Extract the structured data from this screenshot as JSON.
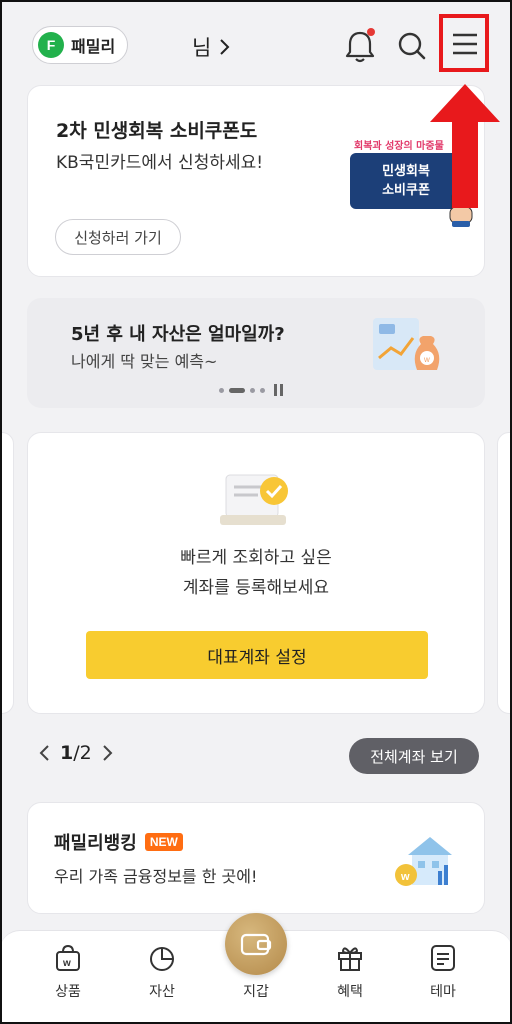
{
  "header": {
    "family_label": "패밀리",
    "family_icon_letter": "F",
    "user_name": "님"
  },
  "promo": {
    "title": "2차 민생회복 소비쿠폰도",
    "subtitle": "KB국민카드에서 신청하세요!",
    "button": "신청하러 가기",
    "art_caption": "회복과 성장의 마중물",
    "art_line1": "민생회복",
    "art_line2": "소비쿠폰"
  },
  "asset_banner": {
    "title": "5년 후 내 자산은 얼마일까?",
    "subtitle": "나에게 딱 맞는 예측~"
  },
  "account_card": {
    "message_line1": "빠르게 조회하고 싶은",
    "message_line2": "계좌를 등록해보세요",
    "button": "대표계좌 설정"
  },
  "pager": {
    "current": "1",
    "separator": "/",
    "total": "2",
    "all_accounts_button": "전체계좌 보기"
  },
  "family_banking": {
    "title": "패밀리뱅킹",
    "badge": "NEW",
    "subtitle": "우리 가족 금융정보를 한 곳에!"
  },
  "bottom_nav": {
    "products": "상품",
    "assets": "자산",
    "wallet": "지갑",
    "benefits": "혜택",
    "theme": "테마"
  },
  "colors": {
    "accent_yellow": "#f8cc2f",
    "family_green": "#22b14c",
    "highlight_red": "#e8191c",
    "new_badge_orange": "#ff6d12",
    "coupon_navy": "#1c3f78"
  }
}
